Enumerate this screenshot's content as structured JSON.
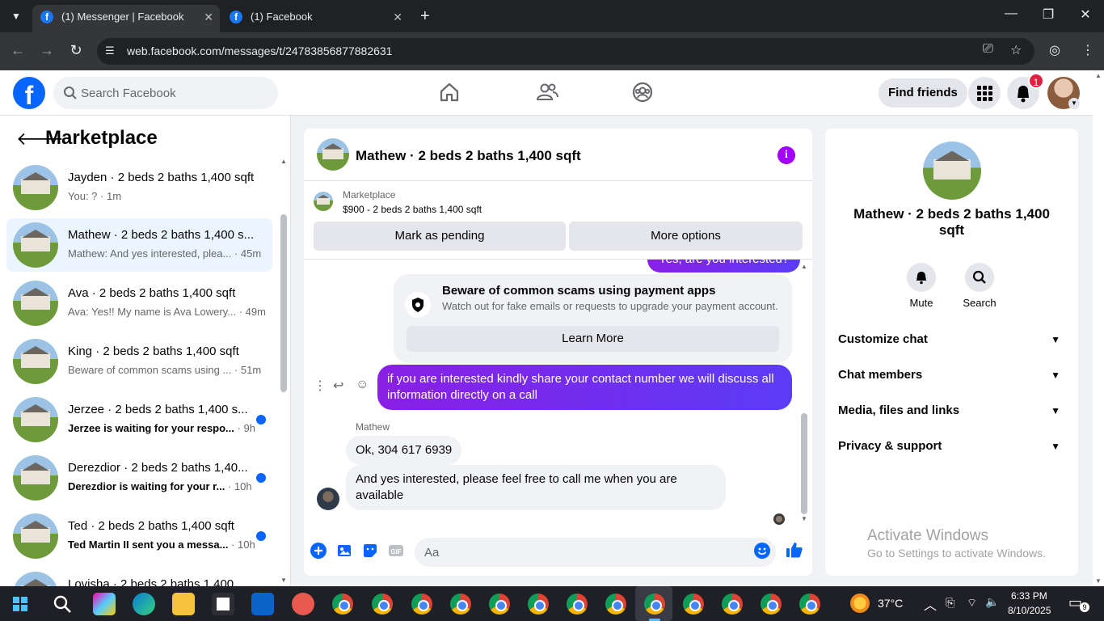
{
  "browser": {
    "tabs": [
      {
        "title": "(1) Messenger | Facebook",
        "active": true
      },
      {
        "title": "(1) Facebook",
        "active": false
      }
    ],
    "url": "web.facebook.com/messages/t/24783856877882631"
  },
  "header": {
    "search_placeholder": "Search Facebook",
    "find_friends": "Find friends",
    "notification_count": "1"
  },
  "marketplace": {
    "title": "Marketplace",
    "conversations": [
      {
        "name": "Jayden · 2 beds 2 baths 1,400 sqft",
        "preview": "You: ?",
        "time": " · 1m",
        "unread": false,
        "selected": false
      },
      {
        "name": "Mathew · 2 beds 2 baths 1,400 s...",
        "preview": "Mathew: And yes interested, plea...",
        "time": " · 45m",
        "unread": false,
        "selected": true
      },
      {
        "name": "Ava · 2 beds 2 baths 1,400 sqft",
        "preview": "Ava: Yes!! My name is Ava Lowery...",
        "time": " · 49m",
        "unread": false,
        "selected": false
      },
      {
        "name": "King · 2 beds 2 baths 1,400 sqft",
        "preview": "Beware of common scams using ...",
        "time": " · 51m",
        "unread": false,
        "selected": false
      },
      {
        "name": "Jerzee · 2 beds 2 baths 1,400 s...",
        "preview": "Jerzee is waiting for your respo...",
        "time": " · 9h",
        "unread": true,
        "selected": false
      },
      {
        "name": "Derezdior · 2 beds 2 baths 1,40...",
        "preview": "Derezdior is waiting for your r...",
        "time": " · 10h",
        "unread": true,
        "selected": false
      },
      {
        "name": "Ted · 2 beds 2 baths 1,400 sqft",
        "preview": "Ted Martin II sent you a messa...",
        "time": " · 10h",
        "unread": true,
        "selected": false
      },
      {
        "name": "Lovisha · 2 beds 2 baths 1,400",
        "preview": "",
        "time": "",
        "unread": false,
        "selected": false
      }
    ]
  },
  "chat": {
    "title": "Mathew · 2 beds 2 baths 1,400 sqft",
    "listing_label": "Marketplace",
    "listing_detail": "$900 - 2 beds 2 baths 1,400 sqft",
    "mark_pending": "Mark as pending",
    "more_options": "More options",
    "partial_bubble": "Yes, are you interested?",
    "scam_title": "Beware of common scams using payment apps",
    "scam_text": "Watch out for fake emails or requests to upgrade your payment account.",
    "learn_more": "Learn More",
    "outgoing": "if you are interested kindly share your contact number we will discuss all information directly on a call",
    "sender": "Mathew",
    "incoming": [
      "Ok, 304 617 6939",
      "And yes interested, please feel free to call me when you are available"
    ],
    "composer_placeholder": "Aa"
  },
  "details": {
    "name": "Mathew · 2 beds 2 baths 1,400 sqft",
    "actions": [
      {
        "label": "Mute",
        "icon": "bell-icon"
      },
      {
        "label": "Search",
        "icon": "search-icon"
      }
    ],
    "sections": [
      "Customize chat",
      "Chat members",
      "Media, files and links",
      "Privacy & support"
    ]
  },
  "watermark": {
    "line1": "Activate Windows",
    "line2": "Go to Settings to activate Windows."
  },
  "taskbar": {
    "weather": "37°C",
    "time": "6:33 PM",
    "date": "8/10/2025",
    "notif_count": "9"
  },
  "colors": {
    "fb_blue": "#0866ff",
    "bubble_purple": "#7c2cf0",
    "info_purple": "#a100ff",
    "selected_bg": "#ebf5ff"
  }
}
